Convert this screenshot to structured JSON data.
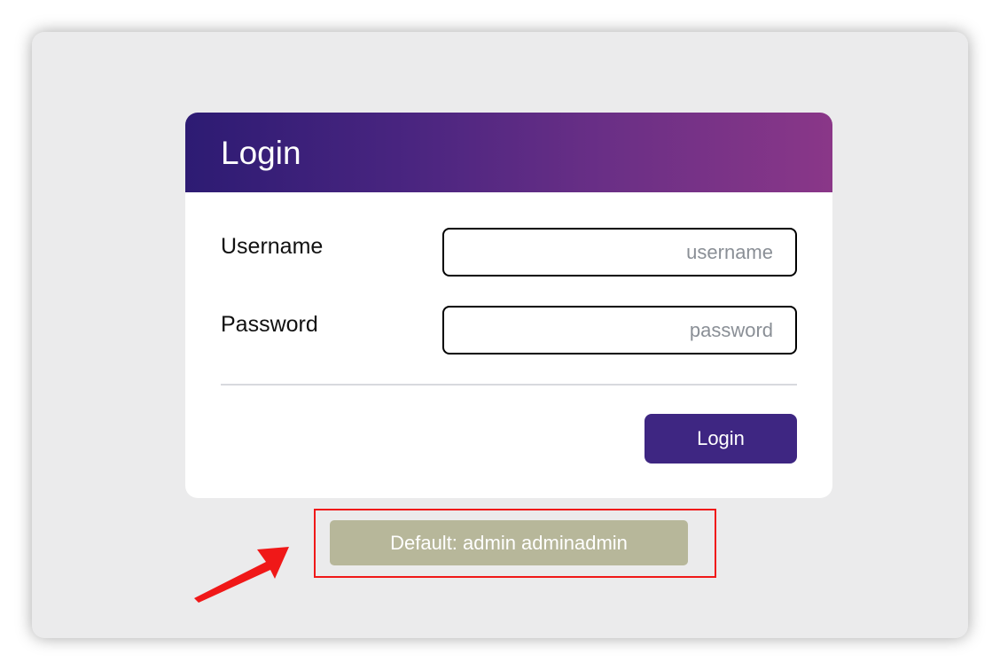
{
  "login_card": {
    "title": "Login",
    "username": {
      "label": "Username",
      "value": "",
      "placeholder": "username"
    },
    "password": {
      "label": "Password",
      "value": "",
      "placeholder": "password"
    },
    "submit_label": "Login"
  },
  "hint": {
    "text": "Default: admin adminadmin"
  },
  "colors": {
    "header_gradient_start": "#2d1b73",
    "header_gradient_end": "#8a3788",
    "button": "#3e2682",
    "hint_badge": "#b7b79a",
    "annotation": "#f01818"
  },
  "icons": {
    "annotation_arrow": "arrow-pointer-icon"
  }
}
